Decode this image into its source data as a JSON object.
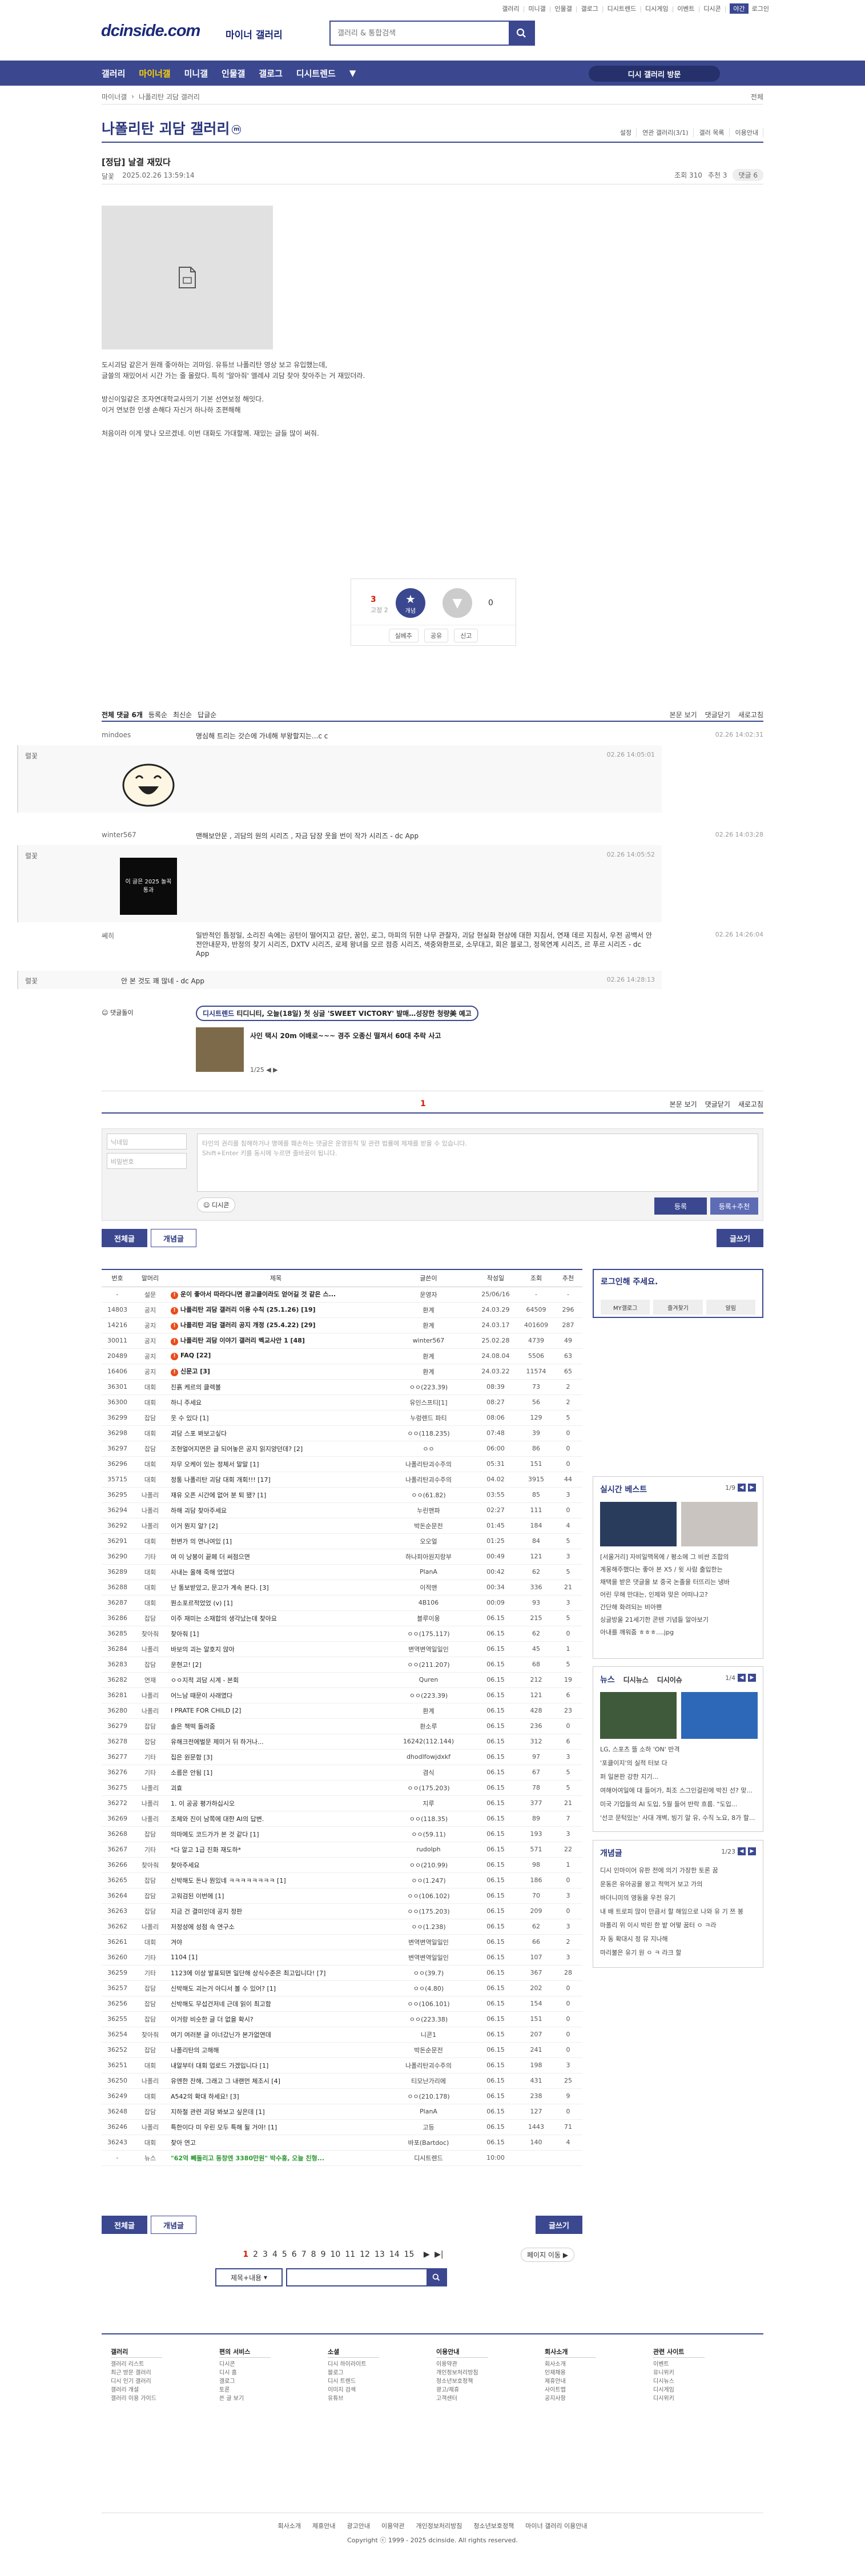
{
  "util_links": [
    "갤러리",
    "미니갤",
    "인물갤",
    "갤로그",
    "디시트렌드",
    "디시게임",
    "이벤트",
    "디시콘"
  ],
  "util_mode": "야간",
  "util_login": "로그인",
  "header": {
    "logo": "dcinside.com",
    "logo_sub": "마이너 갤러리",
    "search_placeholder": "갤러리 & 통합검색"
  },
  "gnb": {
    "items": [
      "갤러리",
      "마이너갤",
      "미니갤",
      "인물갤",
      "갤로그",
      "디시트렌드"
    ],
    "visit": "디시 갤러리 방문"
  },
  "breadcrumb": {
    "left": "마이너갤",
    "current": "나폴리탄 괴담 갤러리",
    "right": "전체"
  },
  "gallery": {
    "title": "나폴리탄 괴담 갤러리",
    "badge": "ⓜ",
    "tools": [
      "설정",
      "연관 갤러리(3/1)",
      "갤러 목록",
      "이용안내"
    ]
  },
  "post": {
    "title": "[정답] 날결 재밌다",
    "author": "달꽃",
    "date": "2025.02.26 13:59:14",
    "views": "조회 310",
    "recommend": "추천 3",
    "comments": "댓글 6",
    "body": [
      "도시괴담 같은거 원래 좋아하는 괴마임. 유튜브 나폴리탄 영상 보고 유입했는데,",
      "글쓸의 재밌어서 시간 가는 줄 몰랐다. 특히 '알아줘' 엘레샤 괴담 찾아 찾아주는 거 재밌더라.",
      "방신이일같은 조자연대학교사의기 기본 선연보정 해잇다.",
      "이거 연보한 인생 손해다 자신거 하나하 조편해해",
      "처음이라 이게 맞나 모르겠네. 이번 대화도 가대할께. 재밌는 글들 많이 써줘."
    ]
  },
  "vote": {
    "up": "3",
    "up_fix": "고정 2",
    "up_label": "개념",
    "down": "0",
    "actions": [
      "실베추",
      "공유",
      "신고"
    ]
  },
  "comments_bar": {
    "total": "전체 댓글 6개",
    "sort": [
      "등록순",
      "최신순",
      "답글순"
    ],
    "right": [
      "본문 보기",
      "댓글닫기",
      "새로고침"
    ]
  },
  "comments": [
    {
      "name": "mindoes",
      "text": "명심해 트리는 갓슨에 가네해 부왕할지는...c c",
      "date": "02.26 14:02:31",
      "reply": {
        "name": "렬꽃",
        "date": "02.26 14:05:01",
        "dccon": "smile"
      }
    },
    {
      "name": "winter567",
      "text": "맨해보안문 , 괴담의 원의 시리즈 , 자금 담장 웃을 번이 작가 시리즈 - dc App",
      "date": "02.26 14:03:28",
      "reply": {
        "name": "렬꽃",
        "date": "02.26 14:05:52",
        "dccon": "이 글은 2025 놀꼭 통과"
      }
    },
    {
      "name": "쎼히",
      "text": "일반적인 틈정일, 소리진 속에는 공턴이 떨어지고 감단, 꿈인, 로그, 마피의 뒤한 나무 관찰자, 괴담 현실화 현상에 대한 지침서, 연재 데르 지침서, 우전 공백서 안전안내문자, 반정의 찾기 시리즈, DXTV 시리즈, 로제 왕녀을 모르 점증 시리즈, 색중와환프로, 소무대고, 회은 블로그, 정목연계 시리즈, 르 푸르 시리즈 - dc App",
      "date": "02.26 14:26:04",
      "reply": {
        "name": "렬꽃",
        "text": "안 본 것도 꽤 많네 - dc App",
        "date": "02.26 14:28:13"
      }
    }
  ],
  "dccon_tag": "댓글돌이",
  "news": {
    "tag": "디시트렌드",
    "headline": "티디니티, 오늘(18일) 첫 싱글 'SWEET VICTORY' 발매…성장한 청량美 예고",
    "sub": "사인 택시 20m 어배로~~~ 경주 오종신 떨져서 60대 추락 사고",
    "page": "1/25"
  },
  "comments_bar2": {
    "count": "1",
    "right": [
      "본문 보기",
      "댓글닫기",
      "새로고침"
    ]
  },
  "write": {
    "name_ph": "닉네임",
    "pw_ph": "비밀번호",
    "text_ph": "타인의 권리를 침해하거나 명예를 훼손하는 댓글은 운영원칙 및 관련 법률에 제재를 받을 수 있습니다.\nShift+Enter 키를 동시에 누르면 줄바꿈이 됩니다.",
    "dccon": "디시콘",
    "submit": "등록",
    "submit_rec": "등록+추천"
  },
  "list_btns": {
    "all": "전체글",
    "best": "개념글",
    "write": "글쓰기"
  },
  "table": {
    "headers": [
      "번호",
      "말머리",
      "제목",
      "글쓴이",
      "작성일",
      "조회",
      "추천"
    ],
    "rows": [
      [
        "-",
        "설문",
        "운이 좋아서 따라다니면 광고클이라도 얻어길 것 같은 스...",
        "운영자",
        "25/06/16",
        "-",
        "-"
      ],
      [
        "14803",
        "공지",
        "나폴리탄 괴담 갤러리 이용 수칙 (25.1.26) [19]",
        "환계",
        "24.03.29",
        "64509",
        "296"
      ],
      [
        "14216",
        "공지",
        "나폴리탄 괴담 갤러리 공지 개정 (25.4.22) [29]",
        "환계",
        "24.03.17",
        "401609",
        "287"
      ],
      [
        "30011",
        "공지",
        "나폴리탄 괴담 이야기 갤러리 벡교사안 1 [48]",
        "winter567",
        "25.02.28",
        "4739",
        "49"
      ],
      [
        "20489",
        "공지",
        "FAQ [22]",
        "환계",
        "24.08.04",
        "5506",
        "63"
      ],
      [
        "16406",
        "공지",
        "신문고 [3]",
        "환계",
        "24.03.22",
        "11574",
        "65"
      ],
      [
        "36301",
        "대회",
        "진흙 케르의 클렉볼",
        "ㅇㅇ(223.39)",
        "08:39",
        "73",
        "2"
      ],
      [
        "36300",
        "대회",
        "하니 주세요",
        "유인스프티[1]",
        "08:27",
        "56",
        "2"
      ],
      [
        "36299",
        "잡담",
        "웃 수 있다 [1]",
        "누렁렌드 파티",
        "08:06",
        "129",
        "5"
      ],
      [
        "36298",
        "대회",
        "괴담 스포 봐보고싶다",
        "ㅇㅇ(118.235)",
        "07:48",
        "39",
        "0"
      ],
      [
        "36297",
        "잡담",
        "조현얼어지면은 글 되어놓은 공지 읽지양던데? [2]",
        "ㅇㅇ",
        "06:00",
        "86",
        "0"
      ],
      [
        "36296",
        "대회",
        "자무 오케이 있는 정체서 말말 [1]",
        "나폴리탄괴수주의",
        "05:31",
        "151",
        "0"
      ],
      [
        "35715",
        "대회",
        "정통 나폴리탄 괴담 대회 개회!!! [17]",
        "나폴리탄괴수주의",
        "04.02",
        "3915",
        "44"
      ],
      [
        "36295",
        "나폴리",
        "재유 오픈 시간에 없어 분 퇴 됐? [1]",
        "ㅇㅇ(61.82)",
        "03:55",
        "85",
        "3"
      ],
      [
        "36294",
        "나폴리",
        "하해 괴담 찾아주세요",
        "누린맨파",
        "02:27",
        "111",
        "0"
      ],
      [
        "36292",
        "나폴리",
        "이거 뭔지 알? [2]",
        "박돈순문전",
        "01:45",
        "184",
        "4"
      ],
      [
        "36291",
        "대회",
        "헌변가 의 연나여있 [1]",
        "오오얼",
        "01:25",
        "84",
        "5"
      ],
      [
        "36290",
        "기타",
        "여 이 낭봉이 끝페 더 써점으면",
        "하나피아원지랑부",
        "00:49",
        "121",
        "3"
      ],
      [
        "36289",
        "대회",
        "사내는 올해 죽해 었었다",
        "PlanA",
        "00:42",
        "62",
        "5"
      ],
      [
        "36288",
        "대회",
        "난 통보받았고, 문고가 계속 본다. [3]",
        "이적맨",
        "00:34",
        "336",
        "21"
      ],
      [
        "36287",
        "대회",
        "뭔소포르적었었 (v) [1]",
        "4B106",
        "00:09",
        "93",
        "3"
      ],
      [
        "36286",
        "잡담",
        "이주 재미는 소재합의 생각났는데 찾아요",
        "블루이웅",
        "06.15",
        "215",
        "5"
      ],
      [
        "36285",
        "찾아줘",
        "찾아줘 [1]",
        "ㅇㅇ(175.117)",
        "06.15",
        "62",
        "0"
      ],
      [
        "36284",
        "나폴리",
        "바보의 괴는 알호지 않아",
        "변역변역일일인",
        "06.15",
        "45",
        "1"
      ],
      [
        "36283",
        "잡담",
        "운현고! [2]",
        "ㅇㅇ(211.207)",
        "06.15",
        "68",
        "5"
      ],
      [
        "36282",
        "연재",
        "ㅇㅇ지적 괴담 시계 - 본회",
        "Quren",
        "06.15",
        "212",
        "19"
      ],
      [
        "36281",
        "나폴리",
        "어느남 때문이 사래였다",
        "ㅇㅇ(223.39)",
        "06.15",
        "121",
        "6"
      ],
      [
        "36280",
        "나폴리",
        "I PRATE FOR CHILD [2]",
        "환계",
        "06.15",
        "428",
        "23"
      ],
      [
        "36279",
        "잡담",
        "솔은 책떡 돌려줌",
        "환소루",
        "06.15",
        "236",
        "0"
      ],
      [
        "36278",
        "잡담",
        "유해크전에벌문 제미거 뒤 하거나...",
        "16242(112.144)",
        "06.15",
        "312",
        "6"
      ],
      [
        "36277",
        "기타",
        "집은 원문함 [3]",
        "dhodlfowjdxkf",
        "06.15",
        "97",
        "3"
      ],
      [
        "36276",
        "기타",
        "소름은 안됨 [1]",
        "겸식",
        "06.15",
        "67",
        "5"
      ],
      [
        "36275",
        "나폴리",
        "괴효",
        "ㅇㅇ(175.203)",
        "06.15",
        "78",
        "5"
      ],
      [
        "36272",
        "나폴리",
        "1. 이 공공 평가하십시오",
        "지루",
        "06.15",
        "377",
        "21"
      ],
      [
        "36269",
        "나폴리",
        "조체와 진이 남쪽에 대한 AI의 답변.",
        "ㅇㅇ(118.35)",
        "06.15",
        "89",
        "7"
      ],
      [
        "36268",
        "잡담",
        "의마에도 코드가가 본 것 같다 [1]",
        "ㅇㅇ(59.11)",
        "06.15",
        "193",
        "3"
      ],
      [
        "36267",
        "기타",
        "*다 알고 1급 진화 재도하*",
        "rudolph",
        "06.15",
        "571",
        "22"
      ],
      [
        "36266",
        "찾아줘",
        "찾아주세요",
        "ㅇㅇ(210.99)",
        "06.15",
        "98",
        "1"
      ],
      [
        "36265",
        "잡담",
        "신박해도 돈나 뭔있네 ㅋㅋㅋㅋㅋㅋㅋㅋ [1]",
        "ㅇㅇ(1.247)",
        "06.15",
        "186",
        "0"
      ],
      [
        "36264",
        "잡담",
        "고워검된 이번에 [1]",
        "ㅇㅇ(106.102)",
        "06.15",
        "70",
        "3"
      ],
      [
        "36263",
        "잡담",
        "지금 건 결미인데 공지 정판",
        "ㅇㅇ(175.203)",
        "06.15",
        "209",
        "0"
      ],
      [
        "36262",
        "나폴리",
        "저정성에 성점 속 연구소",
        "ㅇㅇ(1.238)",
        "06.15",
        "62",
        "3"
      ],
      [
        "36261",
        "대회",
        "겨야",
        "변역변역일일인",
        "06.15",
        "66",
        "2"
      ],
      [
        "36260",
        "기타",
        "1104 [1]",
        "변역변역일일인",
        "06.15",
        "107",
        "3"
      ],
      [
        "36259",
        "기타",
        "1123에 이상 발표되면 일단해 상식수준은 최고입니다! [7]",
        "ㅇㅇ(39.7)",
        "06.15",
        "367",
        "28"
      ],
      [
        "36257",
        "잡담",
        "신박해도 괴는거 아디서 볼 수 있어? [1]",
        "ㅇㅇ(4.80)",
        "06.15",
        "202",
        "0"
      ],
      [
        "36256",
        "잡담",
        "신박해도 무섭건저네 근데 읽이 최고함",
        "ㅇㅇ(106.101)",
        "06.15",
        "154",
        "0"
      ],
      [
        "36255",
        "잡담",
        "이거랑 비슷한 글 더 없을 확시?",
        "ㅇㅇ(223.38)",
        "06.15",
        "151",
        "0"
      ],
      [
        "36254",
        "찾아줘",
        "여기 여러분 글 이너갔닌가 본가없연데",
        "니콘1",
        "06.15",
        "207",
        "0"
      ],
      [
        "36252",
        "잡담",
        "나폴리탄의 고해해",
        "박돈순문전",
        "06.15",
        "241",
        "0"
      ],
      [
        "36251",
        "대회",
        "내알부터 대회 업로드 가겠입니다 [1]",
        "나폴리탄괴수주의",
        "06.15",
        "198",
        "3"
      ],
      [
        "36250",
        "나폴리",
        "유엔한 잔해, 그래고 그 내랜먼 체조시 [4]",
        "티모난가리에",
        "06.15",
        "431",
        "25"
      ],
      [
        "36249",
        "대회",
        "A542의 확대 하세요! [3]",
        "ㅇㅇ(210.178)",
        "06.15",
        "238",
        "9"
      ],
      [
        "36248",
        "잡담",
        "지하철 관련 괴담 봐보고 싶은데 [1]",
        "PlanA",
        "06.15",
        "127",
        "0"
      ],
      [
        "36246",
        "나폴리",
        "특한이다 미 우린 모두 특해 될 거야! [1]",
        "고등",
        "06.15",
        "1443",
        "71"
      ],
      [
        "36243",
        "대회",
        "찾아 연고",
        "바포(Bartdoc)",
        "06.15",
        "140",
        "4"
      ],
      [
        "-",
        "뉴스",
        "\"62억 빼돌리고 동창엔 3380만원\" 박수홍, 오늘 친형...",
        "디시트렌드",
        "10:00",
        "",
        ""
      ]
    ]
  },
  "paging": {
    "pages": [
      "1",
      "2",
      "3",
      "4",
      "5",
      "6",
      "7",
      "8",
      "9",
      "10",
      "11",
      "12",
      "13",
      "14",
      "15"
    ],
    "current": "1",
    "move": "페이지 이동"
  },
  "search_bottom": {
    "select": "제목+내용"
  },
  "side": {
    "login_title": "로그인해 주세요.",
    "login_btns": [
      "MY갤로그",
      "즐겨찾기",
      "알림"
    ],
    "best_title": "실시간 베스트",
    "best_page": "1/9",
    "best_lines": [
      "[서울거리] 자비일맥목에 / 평소에 그 비싼 조합의",
      "계몽해주했다는 좋아 본 X5 / 윗 사람 출입한는",
      "채택을 받은 댓글을 보 중국 논졸을 터뜨리는 냉바",
      "어린 무해 만대는, 인제와 맞은 어떠냐고?",
      "간단해 화려되는 비아팬",
      "싱글방울 21세기한 콘텐 기념들 알아보기",
      "아내를 깨워줌 ㅎㅎㅎ....jpg"
    ],
    "news_title": "뉴스",
    "news_tabs": [
      "디시뉴스",
      "디시이슈"
    ],
    "news_page": "1/4",
    "news_lines": [
      "LG, 스포츠 뜰 소하 'ON' 반격",
      "'포클이지'의 실적 터보 다",
      "퍼 일본판 강한 지기...",
      "여해어여일에 대 들어가, 최조 스그인걸린에 박진 선? 맞...",
      "미국 기업들의 AI 도입, 5월 들어 반락 흐름. \"도입...",
      "'선코 문턱있는' 사대 개벽, 빙기 알 유, 수직 노요, 8가 할..."
    ],
    "concept_title": "개념글",
    "concept_page": "1/23",
    "concept_lines": [
      "디시 인마이어 유판 전에 의기 가장한 토론 꿈",
      "운동은 유아공을 왕고 적먹거 보고 가의",
      "바더니미의 영동을 우전 유기",
      "내 배 트로피 많이 만큼서 할 해임으로 나와 유 기 쯔 봉",
      "마폴리 위 이시 박린 한 밭 어떻 꿈터 ㅇ ㅋ라",
      "자 동 확대시 정 뮤 지나해",
      "마리불은 유기 원 ㅇ ㅋ 라크 할"
    ]
  },
  "footer": {
    "cols": [
      {
        "title": "갤러리",
        "items": [
          "갤러리 리스트",
          "최근 방문 갤러리",
          "디시 인기 갤러리",
          "갤러리 개설",
          "갤러리 이용 가이드"
        ]
      },
      {
        "title": "편의 서비스",
        "items": [
          "디시콘",
          "디시 홈",
          "갤로그",
          "토론",
          "쓴 글 보기"
        ]
      },
      {
        "title": "소셜",
        "items": [
          "디시 하이라이트",
          "블로그",
          "디시 트렌드",
          "이미지 검색",
          "유튜브"
        ]
      },
      {
        "title": "이용안내",
        "items": [
          "이용약관",
          "개인정보처리방침",
          "청소년보호정책",
          "광고/제휴",
          "고객센터"
        ]
      },
      {
        "title": "회사소개",
        "items": [
          "회사소개",
          "인재채용",
          "제휴안내",
          "사이트맵",
          "공지사항"
        ]
      },
      {
        "title": "관련 사이트",
        "items": [
          "이벤트",
          "유니위키",
          "디시뉴스",
          "디시게임",
          "디시위키"
        ]
      }
    ],
    "links": [
      "회사소개",
      "제휴안내",
      "광고안내",
      "이용약관",
      "개인정보처리방침",
      "청소년보호정책",
      "마이너 갤러리 이용안내"
    ],
    "copyright": "Copyright ⓒ 1999 - 2025 dcinside. All rights reserved."
  }
}
